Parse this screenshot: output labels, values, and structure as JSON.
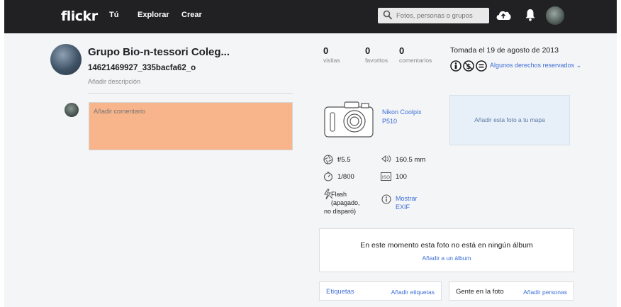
{
  "topbar": {
    "logo": "flickr",
    "nav": [
      "Tú",
      "Explorar",
      "Crear"
    ],
    "search_placeholder": "Fotos, personas o grupos"
  },
  "photo": {
    "group_title": "Grupo Bio-n-tessori Coleg...",
    "title": "14621469927_335bacfa62_o",
    "add_description": "Añadir descripción",
    "comment_placeholder": "Añadir comentario"
  },
  "stats": [
    {
      "number": "0",
      "label": "visitas"
    },
    {
      "number": "0",
      "label": "favoritos"
    },
    {
      "number": "0",
      "label": "comentarios"
    }
  ],
  "taken": "Tomada el 19 de agosto de 2013",
  "license": {
    "text": "Algunos derechos reservados",
    "chevron": "⌄"
  },
  "camera": {
    "name_line1": "Nikon Coolpix",
    "name_line2": "P510"
  },
  "map": {
    "label": "Añadir esta foto a tu mapa"
  },
  "specs": {
    "aperture": "f/5.5",
    "focal": "160.5 mm",
    "shutter": "1/800",
    "iso": "100",
    "flash_line1": "Flash",
    "flash_line2": "(apagado,",
    "flash_line3": "no disparó)",
    "exif_line1": "Mostrar",
    "exif_line2": "EXIF"
  },
  "album": {
    "message": "En este momento esta foto no está en ningún álbum",
    "add": "Añadir a un álbum"
  },
  "tags": {
    "label": "Etiquetas",
    "add": "Añadir etiquetas"
  },
  "people": {
    "label": "Gente en la foto",
    "add": "Añadir personas"
  },
  "colors": {
    "topbar": "#212124",
    "link": "#3e6ed6",
    "comment_box": "#f8b48a",
    "map_box": "#e7eff8"
  }
}
